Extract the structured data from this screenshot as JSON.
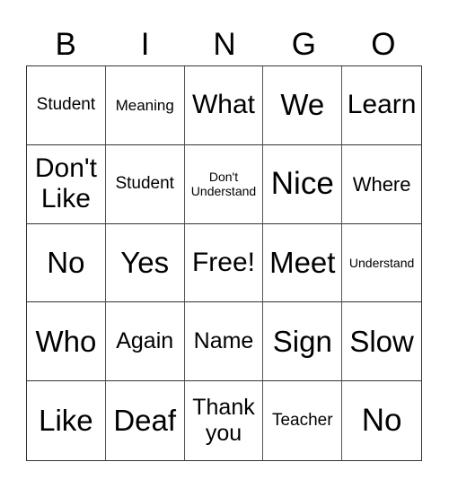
{
  "header": [
    "B",
    "I",
    "N",
    "G",
    "O"
  ],
  "cells": [
    "Student",
    "Meaning",
    "What",
    "We",
    "Learn",
    "Don't Like",
    "Student",
    "Don't Understand",
    "Nice",
    "Where",
    "No",
    "Yes",
    "Free!",
    "Meet",
    "Understand",
    "Who",
    "Again",
    "Name",
    "Sign",
    "Slow",
    "Like",
    "Deaf",
    "Thank you",
    "Teacher",
    "No"
  ]
}
